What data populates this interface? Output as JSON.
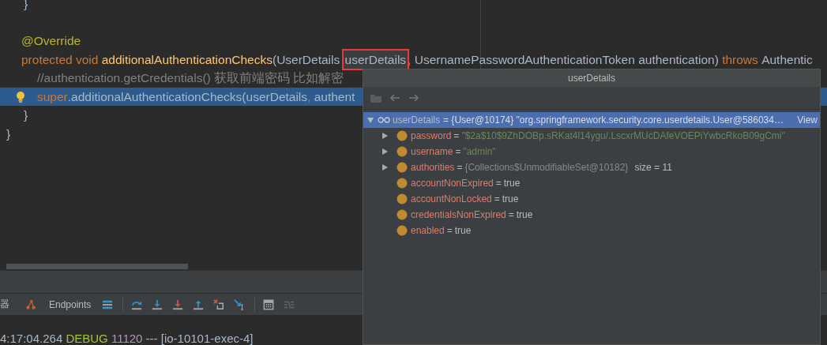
{
  "editor": {
    "lines": [
      {
        "kind": "outer-member",
        "selected": false,
        "tokens": [
          {
            "kind": "plain",
            "text": "}"
          }
        ]
      },
      {
        "kind": "blank"
      },
      {
        "kind": "member",
        "selected": false,
        "tokens": [
          {
            "kind": "annotation",
            "text": "@Override"
          }
        ]
      },
      {
        "kind": "member",
        "selected": false,
        "tokens": [
          {
            "kind": "keyword",
            "text": "protected void "
          },
          {
            "kind": "method",
            "text": "additionalAuthenticationChecks"
          },
          {
            "kind": "plain",
            "text": "(UserDetails "
          },
          {
            "kind": "marked",
            "text": "userDetails"
          },
          {
            "kind": "keyword",
            "text": ","
          },
          {
            "kind": "plain",
            "text": " UsernamePasswordAuthenticationToken authentication) "
          },
          {
            "kind": "keyword",
            "text": "throws "
          },
          {
            "kind": "plain",
            "text": "Authentic"
          }
        ]
      },
      {
        "kind": "body",
        "selected": false,
        "tokens": [
          {
            "kind": "comment",
            "text": "//authentication.getCredentials() 获取前端密码 比如解密"
          }
        ]
      },
      {
        "kind": "body",
        "selected": true,
        "tokens": [
          {
            "kind": "keyword",
            "text": "super"
          },
          {
            "kind": "plain",
            "text": ".additionalAuthenticationChecks(userDetails"
          },
          {
            "kind": "keyword",
            "text": ","
          },
          {
            "kind": "plain",
            "text": " authent"
          }
        ]
      },
      {
        "kind": "outer-member",
        "selected": false,
        "tokens": [
          {
            "kind": "plain",
            "text": "}"
          }
        ]
      },
      {
        "kind": "outer",
        "selected": false,
        "tokens": [
          {
            "kind": "plain",
            "text": "}"
          }
        ]
      }
    ]
  },
  "toolbar": {
    "cut_label": "器",
    "endpoints": "Endpoints"
  },
  "console": {
    "tokens": [
      {
        "kind": "plain",
        "text": "4:17:04.264 "
      },
      {
        "kind": "level",
        "text": "DEBUG"
      },
      {
        "kind": "pid",
        "text": " 11120"
      },
      {
        "kind": "plain",
        "text": " --- [io-10101-exec-4]"
      }
    ]
  },
  "popup": {
    "title": "userDetails",
    "root": {
      "name": "userDetails",
      "value": "= {User@10174} \"org.springframework.security.core.userdetails.User@586034…",
      "link": "View",
      "expanded": true,
      "selected": true,
      "children": [
        {
          "name": "password",
          "operator": "=",
          "kind": "string",
          "value": "\"$2a$10$9ZhDOBp.sRKat4l14ygu/.LscxrMUcDAfeVOEPiYwbcRkoB09gCmi\"",
          "expandable": true
        },
        {
          "name": "username",
          "operator": "=",
          "kind": "string",
          "value": "\"admin\"",
          "expandable": true
        },
        {
          "name": "authorities",
          "operator": "=",
          "kind": "object",
          "value": "{Collections$UnmodifiableSet@10182}",
          "extra": "size = 11",
          "expandable": true
        },
        {
          "name": "accountNonExpired",
          "operator": "=",
          "kind": "plain",
          "value": "true",
          "expandable": false
        },
        {
          "name": "accountNonLocked",
          "operator": "=",
          "kind": "plain",
          "value": "true",
          "expandable": false
        },
        {
          "name": "credentialsNonExpired",
          "operator": "=",
          "kind": "plain",
          "value": "true",
          "expandable": false
        },
        {
          "name": "enabled",
          "operator": "=",
          "kind": "plain",
          "value": "true",
          "expandable": false
        }
      ]
    }
  }
}
